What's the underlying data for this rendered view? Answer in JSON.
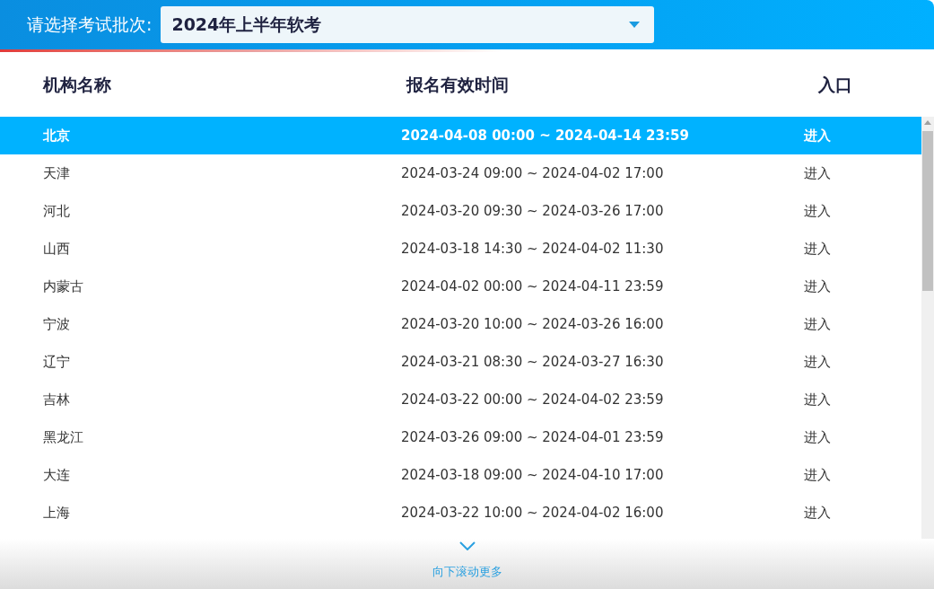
{
  "batch_select": {
    "label": "请选择考试批次:",
    "value": "2024年上半年软考"
  },
  "table": {
    "columns": [
      "机构名称",
      "报名有效时间",
      "入口"
    ],
    "rows": [
      {
        "name": "北京",
        "time": "2024-04-08 00:00 ~ 2024-04-14 23:59",
        "entry": "进入",
        "selected": true
      },
      {
        "name": "天津",
        "time": "2024-03-24 09:00 ~ 2024-04-02 17:00",
        "entry": "进入",
        "selected": false
      },
      {
        "name": "河北",
        "time": "2024-03-20 09:30 ~ 2024-03-26 17:00",
        "entry": "进入",
        "selected": false
      },
      {
        "name": "山西",
        "time": "2024-03-18 14:30 ~ 2024-04-02 11:30",
        "entry": "进入",
        "selected": false
      },
      {
        "name": "内蒙古",
        "time": "2024-04-02 00:00 ~ 2024-04-11 23:59",
        "entry": "进入",
        "selected": false
      },
      {
        "name": "宁波",
        "time": "2024-03-20 10:00 ~ 2024-03-26 16:00",
        "entry": "进入",
        "selected": false
      },
      {
        "name": "辽宁",
        "time": "2024-03-21 08:30 ~ 2024-03-27 16:30",
        "entry": "进入",
        "selected": false
      },
      {
        "name": "吉林",
        "time": "2024-03-22 00:00 ~ 2024-04-02 23:59",
        "entry": "进入",
        "selected": false
      },
      {
        "name": "黑龙江",
        "time": "2024-03-26 09:00 ~ 2024-04-01 23:59",
        "entry": "进入",
        "selected": false
      },
      {
        "name": "大连",
        "time": "2024-03-18 09:00 ~ 2024-04-10 17:00",
        "entry": "进入",
        "selected": false
      },
      {
        "name": "上海",
        "time": "2024-03-22 10:00 ~ 2024-04-02 16:00",
        "entry": "进入",
        "selected": false
      }
    ]
  },
  "scroll_hint": "向下滚动更多"
}
